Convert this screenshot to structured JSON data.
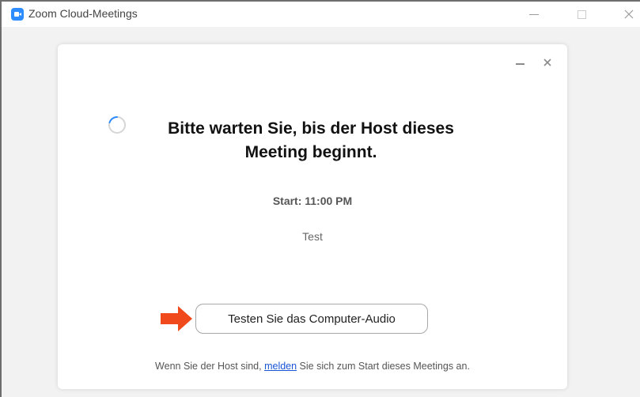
{
  "window": {
    "title": "Zoom Cloud-Meetings",
    "icon": "zoom-camera-icon",
    "controls": [
      "minimize-icon",
      "maximize-icon",
      "close-icon"
    ]
  },
  "waiting": {
    "message": "Bitte warten Sie, bis der Host dieses Meeting beginnt.",
    "start_time": "Start: 11:00 PM",
    "topic": "Test",
    "test_audio_label": "Testen Sie das Computer-Audio",
    "footer_prefix": "Wenn Sie der Host sind, ",
    "footer_link": "melden",
    "footer_suffix": " Sie sich zum Start dieses Meetings an."
  },
  "colors": {
    "accent": "#2d8cff",
    "link": "#1a55d6",
    "arrow": "#f04a1c"
  }
}
